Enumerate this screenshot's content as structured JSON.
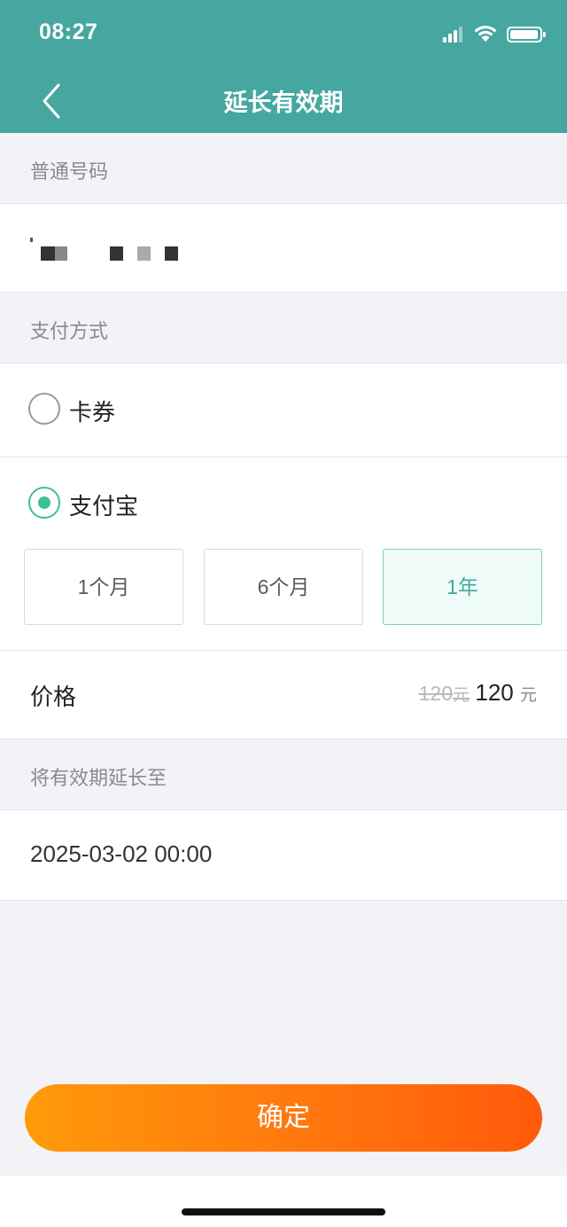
{
  "status_bar": {
    "time": "08:27"
  },
  "nav": {
    "title": "延长有效期",
    "back_icon": "chevron-left-icon"
  },
  "number_section": {
    "heading": "普通号码"
  },
  "payment_section": {
    "heading": "支付方式",
    "options": [
      {
        "label": "卡券",
        "selected": false
      },
      {
        "label": "支付宝",
        "selected": true
      }
    ]
  },
  "periods": [
    {
      "label": "1个月",
      "active": false
    },
    {
      "label": "6个月",
      "active": false
    },
    {
      "label": "1年",
      "active": true
    }
  ],
  "price": {
    "label": "价格",
    "original": "120",
    "original_unit": "元",
    "current": "120",
    "current_unit": "元"
  },
  "extend_section": {
    "heading": "将有效期延长至",
    "value": "2025-03-02 00:00"
  },
  "confirm_label": "确定",
  "colors": {
    "header": "#46a7a0",
    "accent": "#3fbf95",
    "button_start": "#ff9a0a",
    "button_end": "#ff5a0a"
  }
}
